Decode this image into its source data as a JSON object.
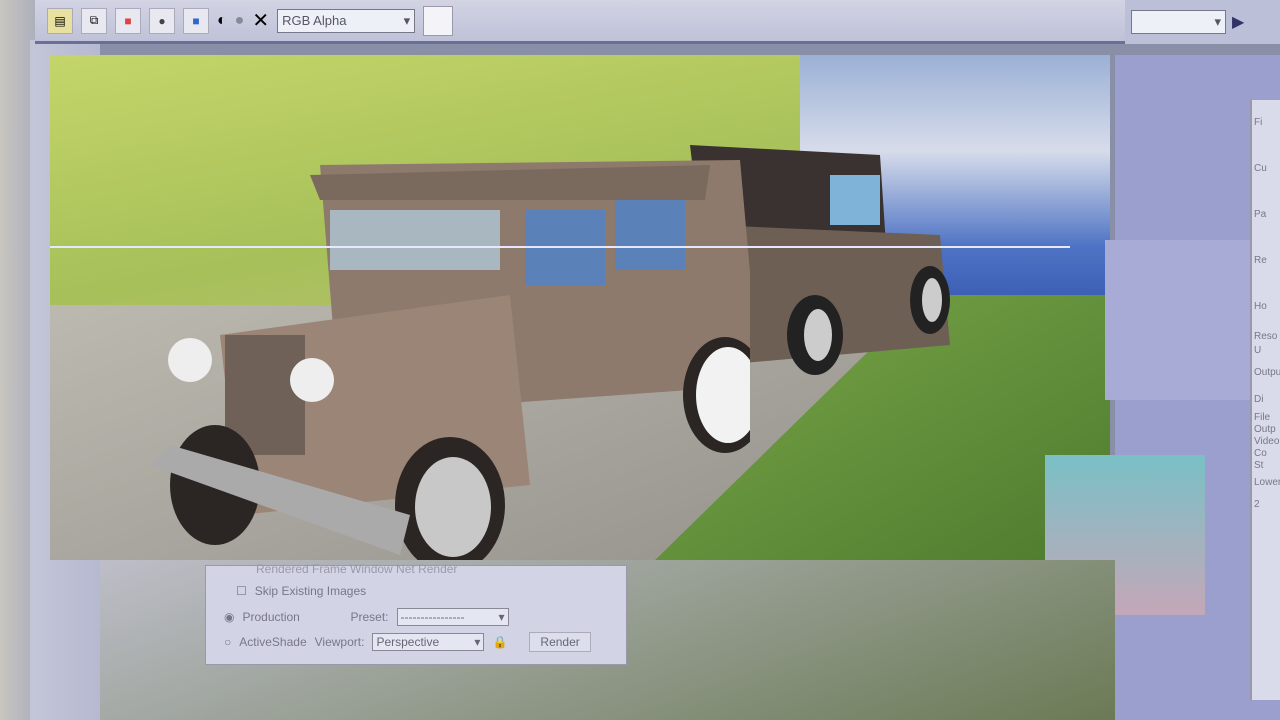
{
  "toolbar": {
    "channel_select": "RGB Alpha"
  },
  "dialog": {
    "partial_top": "Rendered Frame Window   Net Render",
    "skip_existing": "Skip Existing Images",
    "production": "Production",
    "preset_label": "Preset:",
    "preset_value": "----------------",
    "activeshade": "ActiveShade",
    "viewport_label": "Viewport:",
    "viewport_value": "Perspective",
    "render_button": "Render"
  },
  "side_panel": {
    "labels": [
      "Fi",
      "Cu",
      "Pa",
      "Re",
      "Ho",
      "Reso",
      "U",
      "Outpu",
      "Di",
      "File Outp",
      "Video Co",
      "St",
      "Lower 2"
    ]
  }
}
